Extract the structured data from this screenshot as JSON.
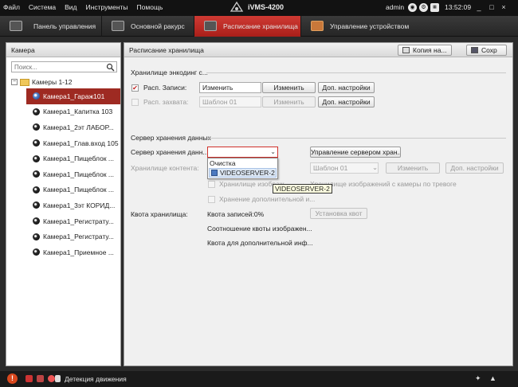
{
  "titlebar": {
    "menus": [
      "Файл",
      "Система",
      "Вид",
      "Инструменты",
      "Помощь"
    ],
    "app_title": "iVMS-4200",
    "user": "admin",
    "clock": "13:52:09",
    "window_buttons": [
      "_",
      "□",
      "×"
    ]
  },
  "tabs": [
    {
      "label": "Панель управления"
    },
    {
      "label": "Основной ракурс"
    },
    {
      "label": "Расписание хранилища"
    },
    {
      "label": "Управление устройством"
    }
  ],
  "left": {
    "title": "Камера",
    "search_placeholder": "Поиск...",
    "root_label": "Камеры 1-12",
    "cameras": [
      "Камера1_Гараж101",
      "Камера1_Капитка 103",
      "Камера1_2эт ЛАБОР...",
      "Камера1_Глав.вход 105",
      "Камера1_Пищеблок ...",
      "Камера1_Пищеблок ...",
      "Камера1_Пищеблок ...",
      "Камера1_3эт КОРИД...",
      "Камера1_Регистрату...",
      "Камера1_Регистрату...",
      "Камера1_Приемное ..."
    ]
  },
  "main": {
    "title": "Расписание хранилища",
    "copy_button": "Копия на...",
    "save_button": "Сохр",
    "encoding_section": "Хранилище энкодинг с...",
    "record_label": "Расп. Записи:",
    "record_checked": true,
    "record_value": "Изменить",
    "record_edit": "Изменить",
    "record_adv": "Доп. настройки",
    "capture_label": "Расп. захвата:",
    "capture_checked": false,
    "capture_value": "Шаблон 01",
    "capture_edit": "Изменить",
    "capture_adv": "Доп. настройки",
    "server_section": "Сервер хранения данных",
    "server_label": "Сервер хранения данн...",
    "server_selected": "",
    "manage_server_button": "Управление сервером хран...",
    "content_label": "Хранилище контента:",
    "content_template": "Шаблон 01",
    "content_edit": "Изменить",
    "content_adv": "Доп. настройки",
    "opt_images": "Хранилище изображ...",
    "opt_alarm_images": "Хранилище изображений с камеры по тревоге",
    "opt_extra": "Хранение дополнительной и...",
    "quota_label": "Квота хранилища:",
    "quota_records": "Квота записей:0%",
    "quota_set_button": "Установка квот",
    "quota_images": "Соотношение квоты изображен...",
    "quota_extra": "Квота для дополнительной инф...",
    "dropdown_options": [
      "Очистка",
      "VIDEOSERVER-2"
    ],
    "tooltip": "VIDEOSERVER-2"
  },
  "statusbar": {
    "motion_label": "Детекция движения"
  },
  "colors": {
    "accent_red": "#a91f1a",
    "selected_row": "#9e2a22"
  }
}
